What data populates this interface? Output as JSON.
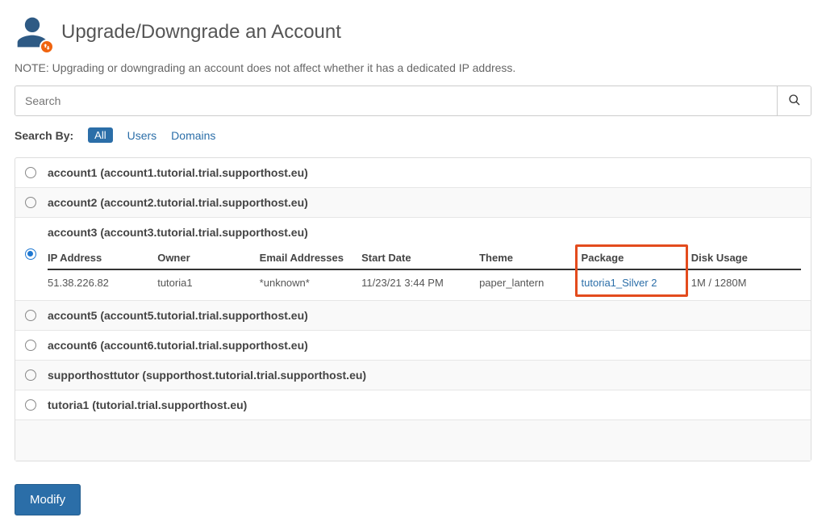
{
  "header": {
    "title": "Upgrade/Downgrade an Account"
  },
  "note": "NOTE: Upgrading or downgrading an account does not affect whether it has a dedicated IP address.",
  "search": {
    "placeholder": "Search"
  },
  "searchby": {
    "label": "Search By:",
    "all": "All",
    "users": "Users",
    "domains": "Domains"
  },
  "detail_headers": {
    "ip": "IP Address",
    "owner": "Owner",
    "email": "Email Addresses",
    "start": "Start Date",
    "theme": "Theme",
    "package": "Package",
    "disk": "Disk Usage"
  },
  "accounts": [
    {
      "label": "account1 (account1.tutorial.trial.supporthost.eu)"
    },
    {
      "label": "account2 (account2.tutorial.trial.supporthost.eu)"
    },
    {
      "label": "account3 (account3.tutorial.trial.supporthost.eu)",
      "selected": true,
      "details": {
        "ip": "51.38.226.82",
        "owner": "tutoria1",
        "email": "*unknown*",
        "start": "11/23/21 3:44 PM",
        "theme": "paper_lantern",
        "package": "tutoria1_Silver 2",
        "disk": "1M / 1280M"
      }
    },
    {
      "label": "account5 (account5.tutorial.trial.supporthost.eu)"
    },
    {
      "label": "account6 (account6.tutorial.trial.supporthost.eu)"
    },
    {
      "label": "supporthosttutor (supporthost.tutorial.trial.supporthost.eu)"
    },
    {
      "label": "tutoria1 (tutorial.trial.supporthost.eu)"
    }
  ],
  "modify_label": "Modify"
}
